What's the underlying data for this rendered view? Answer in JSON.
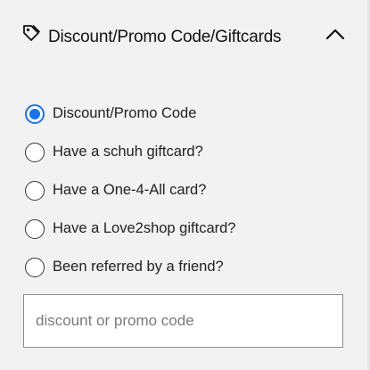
{
  "header": {
    "title": "Discount/Promo Code/Giftcards",
    "icon": "tag-icon",
    "toggle_icon": "chevron-up-icon"
  },
  "options": [
    {
      "label": "Discount/Promo Code",
      "selected": true
    },
    {
      "label": "Have a schuh giftcard?",
      "selected": false
    },
    {
      "label": "Have a One-4-All card?",
      "selected": false
    },
    {
      "label": "Have a Love2shop giftcard?",
      "selected": false
    },
    {
      "label": "Been referred by a friend?",
      "selected": false
    }
  ],
  "code_input": {
    "value": "",
    "placeholder": "discount or promo code"
  },
  "colors": {
    "accent": "#1a73e8",
    "background": "#f2f2f2",
    "input_border": "#8a8a8a"
  }
}
